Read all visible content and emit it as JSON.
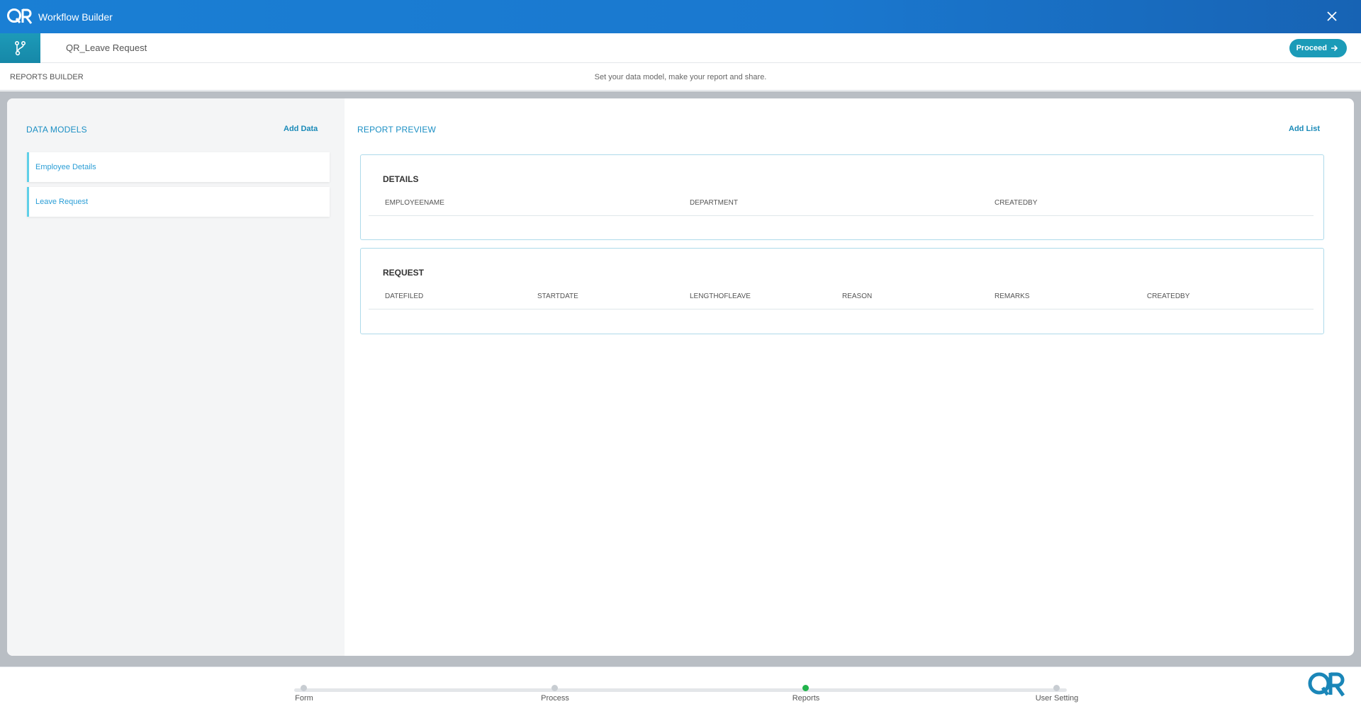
{
  "titlebar": {
    "logo": "QR",
    "title": "Workflow Builder"
  },
  "subheader": {
    "form_name": "QR_Leave Request",
    "proceed_label": "Proceed"
  },
  "section": {
    "title": "REPORTS BUILDER",
    "subtitle": "Set your data model, make your report and share."
  },
  "data_models": {
    "title": "DATA MODELS",
    "add_label": "Add Data",
    "items": [
      "Employee Details",
      "Leave Request"
    ]
  },
  "report_preview": {
    "title": "REPORT PREVIEW",
    "add_label": "Add List",
    "boxes": [
      {
        "title": "DETAILS",
        "columns": [
          "EMPLOYEENAME",
          "DEPARTMENT",
          "CREATEDBY"
        ]
      },
      {
        "title": "REQUEST",
        "columns": [
          "DATEFILED",
          "STARTDATE",
          "LENGTHOFLEAVE",
          "REASON",
          "REMARKS",
          "CREATEDBY"
        ]
      }
    ]
  },
  "stepper": {
    "steps": [
      "Form",
      "Process",
      "Reports",
      "User Setting"
    ],
    "active": "Reports"
  },
  "colors": {
    "accent": "#1b9bb8",
    "titlebar": "#1a7fd4",
    "active_step": "#21b34b"
  },
  "icons": [
    "qr-logo-icon",
    "close-icon",
    "branch-icon",
    "arrow-right-icon",
    "qr-fab-icon"
  ]
}
